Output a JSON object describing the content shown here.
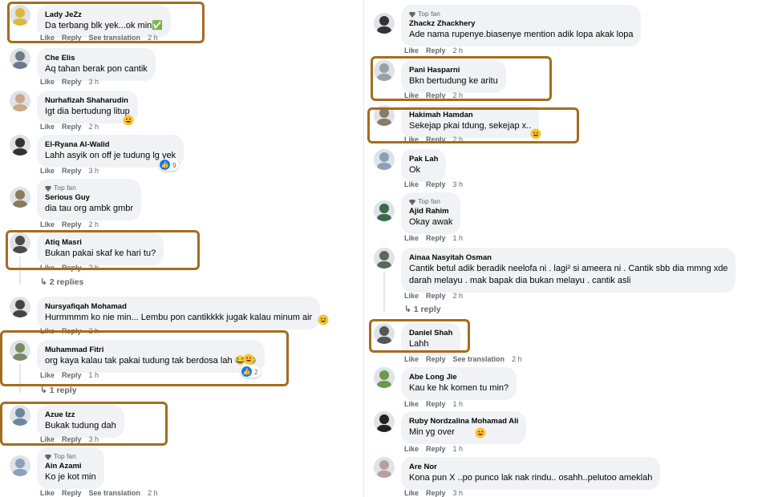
{
  "actions": {
    "like": "Like",
    "reply": "Reply",
    "see_translation": "See translation"
  },
  "top_fan_label": "Top fan",
  "left_comments": [
    {
      "author": "Lady JeZz",
      "text": "Da terbang blk yek...ok min✅",
      "time": "2 h",
      "translate": true
    },
    {
      "author": "Che Elis",
      "text": "Aq tahan berak pon cantik",
      "time": "3 h"
    },
    {
      "author": "Nurhafizah Shaharudin",
      "text": "Igt dia bertudung litup",
      "time": "2 h"
    },
    {
      "author": "El-Ryana Al-Walid",
      "text": "Lahh asyik on off je tudung lg yek",
      "time": "3 h",
      "reaction_count": "9"
    },
    {
      "author": "Serious Guy",
      "text": "dia tau org ambk gmbr",
      "time": "2 h",
      "top_fan": true
    },
    {
      "author": "Atiq Masri",
      "text": "Bukan pakai skaf ke hari tu?",
      "time": "2 h",
      "replies": "2 replies"
    },
    {
      "author": "Nursyafiqah Mohamad",
      "text": "Hurmmmm ko nie min... Lembu pon cantikkkk jugak kalau minum air",
      "time": "2 h"
    },
    {
      "author": "Muhammad Fitri",
      "text": "org kaya kalau tak pakai tudung tak berdosa lah 😂😂",
      "time": "1 h",
      "reaction_count": "2",
      "replies": "1 reply"
    },
    {
      "author": "Azue Izz",
      "text": "Bukak tudung dah",
      "time": "3 h"
    },
    {
      "author": "Ain Azami",
      "text": "Ko je kot min",
      "time": "2 h",
      "top_fan": true,
      "translate": true
    }
  ],
  "right_comments": [
    {
      "author": "Zhackz Zhackhery",
      "text": "Ade nama rupenye.biasenye mention adik lopa akak lopa",
      "time": "2 h",
      "top_fan": true
    },
    {
      "author": "Pani Hasparni",
      "text": "Bkn bertudung ke aritu",
      "time": "2 h"
    },
    {
      "author": "Hakimah Hamdan",
      "text": "Sekejap pkai tdung, sekejap x..",
      "time": "2 h"
    },
    {
      "author": "Pak Lah",
      "text": "Ok",
      "time": "3 h"
    },
    {
      "author": "Ajid Rahim",
      "text": "Okay awak",
      "time": "1 h",
      "top_fan": true
    },
    {
      "author": "Ainaa Nasyitah Osman",
      "text": "Cantik betul adik beradik neelofa ni . lagi² si ameera ni . Cantik sbb dia mmng xde",
      "text2": "darah melayu . mak bapak dia bukan melayu . cantik asli",
      "time": "2 h",
      "replies": "1 reply"
    },
    {
      "author": "Daniel Shah",
      "text": "Lahh",
      "time": "2 h",
      "translate": true
    },
    {
      "author": "Abe Long Jie",
      "text": "Kau ke hk komen tu min?",
      "time": "1 h"
    },
    {
      "author": "Ruby Nordzalina Mohamad Ali",
      "text": "Min yg over",
      "time": "1 h"
    },
    {
      "author": "Are Nor",
      "text": "Kona pun X ..po punco lak nak rindu.. osahh..pelutoo ameklah",
      "time": "3 h"
    }
  ],
  "colors": {
    "highlight": "#a56c1e",
    "bubble": "#f0f2f5",
    "meta": "#65676b",
    "like_blue": "#1877f2"
  }
}
